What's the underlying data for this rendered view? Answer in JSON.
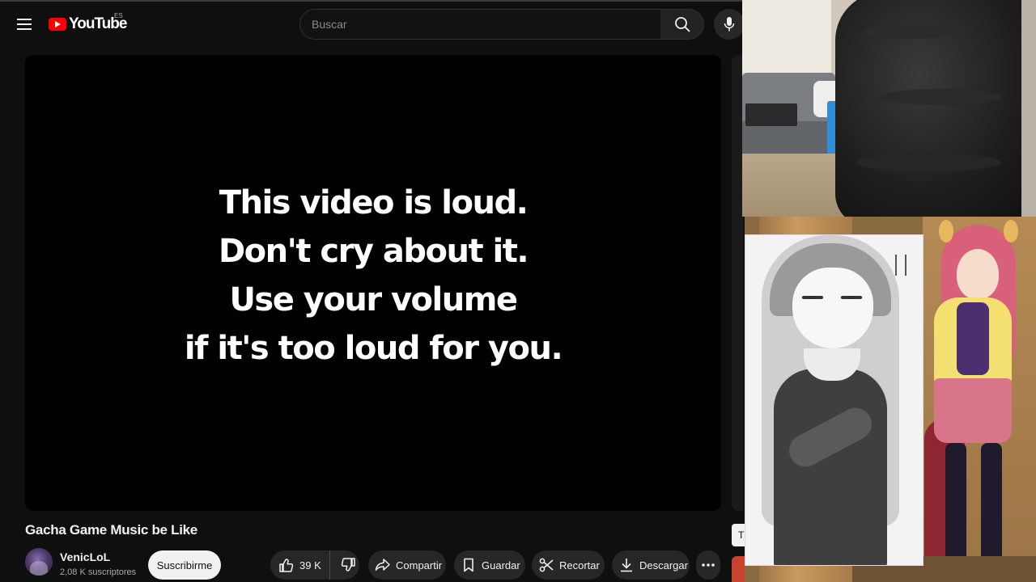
{
  "header": {
    "logo_text": "YouTube",
    "region_code": "ES",
    "search_placeholder": "Buscar"
  },
  "player": {
    "lines": [
      "This video is loud.",
      "Don't cry about it.",
      "Use your volume",
      "if it's too loud for you."
    ]
  },
  "video": {
    "title": "Gacha Game Music be Like"
  },
  "channel": {
    "name": "VenicLoL",
    "subscribers": "2,08 K suscriptores",
    "subscribe_label": "Suscribirme"
  },
  "actions": {
    "like_count": "39 K",
    "share_label": "Compartir",
    "save_label": "Guardar",
    "clip_label": "Recortar",
    "download_label": "Descargar"
  },
  "side": {
    "chip_partial": "T"
  },
  "icons": {
    "menu": "hamburger-icon",
    "search": "search-icon",
    "mic": "microphone-icon",
    "like": "thumbs-up-icon",
    "dislike": "thumbs-down-icon",
    "share": "share-arrow-icon",
    "save": "bookmark-icon",
    "clip": "scissors-icon",
    "download": "download-icon",
    "more": "more-horizontal-icon"
  },
  "colors": {
    "background": "#0f0f0f",
    "brand_red": "#ff0000",
    "pill_bg": "#272727",
    "subscribe_bg": "#f1f1f1"
  }
}
